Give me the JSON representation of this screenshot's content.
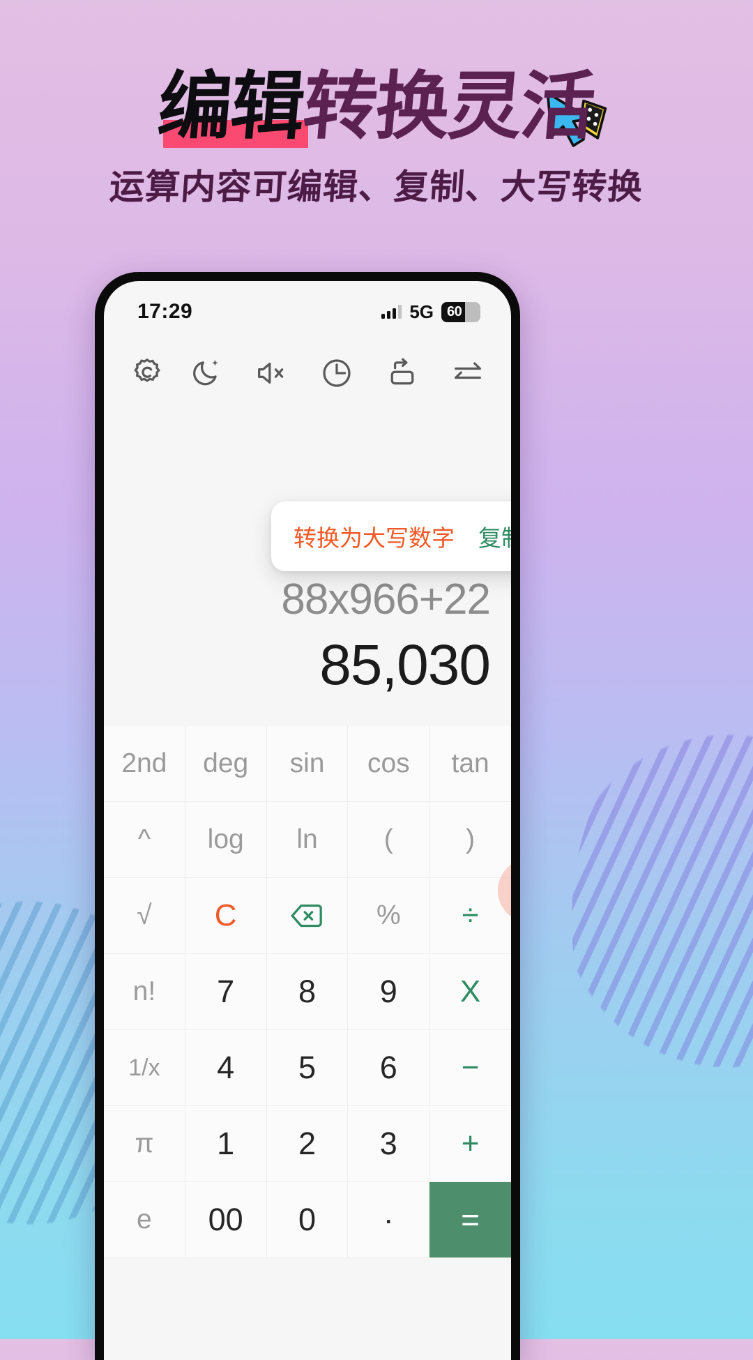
{
  "banner": {
    "headline_part1": "编辑",
    "headline_part2": "转换灵活",
    "subhead": "运算内容可编辑、复制、大写转换",
    "highlight_color": "#fb4a72",
    "headline_color_1": "#0d0d11",
    "headline_color_2": "#5b2150"
  },
  "phone": {
    "status": {
      "time": "17:29",
      "network": "5G",
      "battery_percent": "60"
    },
    "toolbar": {
      "settings": "gear-icon",
      "theme": "moon-sparkle-icon",
      "sound": "speaker-mute-icon",
      "history": "clock-icon",
      "rotate": "rotate-screen-icon",
      "convert": "swap-arrows-icon"
    },
    "context_menu": {
      "convert_label": "转换为大写数字",
      "copy_label": "复制",
      "convert_color": "#f05a28",
      "copy_color": "#2e8b62"
    },
    "display": {
      "expression": "88x966+22",
      "result": "85,030"
    },
    "keypad": {
      "rows": [
        [
          {
            "label": "2nd",
            "type": "fn"
          },
          {
            "label": "deg",
            "type": "fn"
          },
          {
            "label": "sin",
            "type": "fn"
          },
          {
            "label": "cos",
            "type": "fn"
          },
          {
            "label": "tan",
            "type": "fn"
          }
        ],
        [
          {
            "label": "^",
            "type": "fn"
          },
          {
            "label": "log",
            "type": "fn"
          },
          {
            "label": "ln",
            "type": "fn"
          },
          {
            "label": "(",
            "type": "fn"
          },
          {
            "label": ")",
            "type": "fn"
          }
        ],
        [
          {
            "label": "√",
            "type": "fn"
          },
          {
            "label": "C",
            "type": "clr"
          },
          {
            "label": "backspace-icon",
            "type": "icon-backspace"
          },
          {
            "label": "%",
            "type": "fn"
          },
          {
            "label": "÷",
            "type": "op"
          }
        ],
        [
          {
            "label": "n!",
            "type": "fn"
          },
          {
            "label": "7",
            "type": "num"
          },
          {
            "label": "8",
            "type": "num"
          },
          {
            "label": "9",
            "type": "num"
          },
          {
            "label": "X",
            "type": "op"
          }
        ],
        [
          {
            "label": "1/x",
            "type": "fn-sm"
          },
          {
            "label": "4",
            "type": "num"
          },
          {
            "label": "5",
            "type": "num"
          },
          {
            "label": "6",
            "type": "num"
          },
          {
            "label": "−",
            "type": "op"
          }
        ],
        [
          {
            "label": "π",
            "type": "fn"
          },
          {
            "label": "1",
            "type": "num"
          },
          {
            "label": "2",
            "type": "num"
          },
          {
            "label": "3",
            "type": "num"
          },
          {
            "label": "+",
            "type": "op"
          }
        ],
        [
          {
            "label": "e",
            "type": "fn"
          },
          {
            "label": "00",
            "type": "num"
          },
          {
            "label": "0",
            "type": "num"
          },
          {
            "label": "·",
            "type": "num"
          },
          {
            "label": "=",
            "type": "equals"
          }
        ]
      ]
    }
  }
}
